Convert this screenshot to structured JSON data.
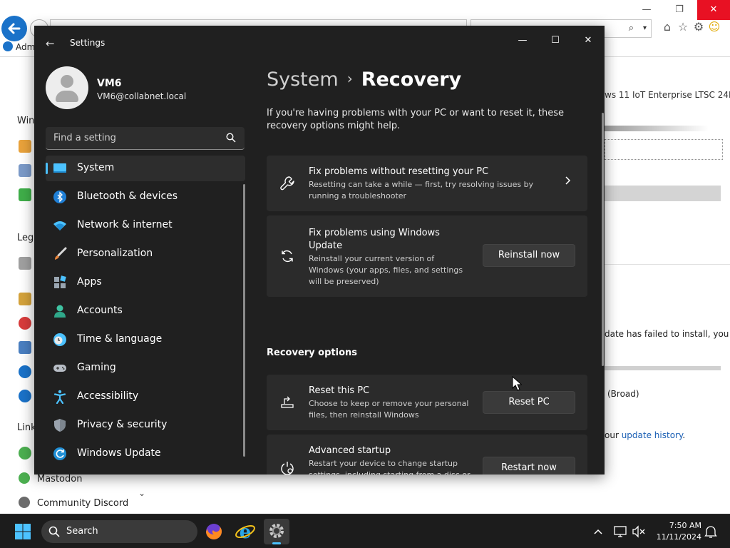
{
  "background_window": {
    "tab_title": "Adm",
    "sidebar_headings": [
      "Win",
      "Leg",
      "Link"
    ],
    "sidebar_links": [
      "Mastodon",
      "Community Discord"
    ],
    "edition_text": "ws 11 IoT Enterprise LTSC 24H2",
    "update_failed_text": "date has failed to install, you",
    "broad_text": "(Broad)",
    "history_prefix": "our ",
    "history_link": "update history",
    "history_suffix": "."
  },
  "settings": {
    "window_title": "Settings",
    "user": {
      "name": "VM6",
      "email": "VM6@collabnet.local"
    },
    "search_placeholder": "Find a setting",
    "nav": [
      {
        "label": "System",
        "icon": "system-display-icon",
        "selected": true
      },
      {
        "label": "Bluetooth & devices",
        "icon": "bluetooth-icon"
      },
      {
        "label": "Network & internet",
        "icon": "wifi-icon"
      },
      {
        "label": "Personalization",
        "icon": "paintbrush-icon"
      },
      {
        "label": "Apps",
        "icon": "apps-icon"
      },
      {
        "label": "Accounts",
        "icon": "account-person-icon"
      },
      {
        "label": "Time & language",
        "icon": "clock-globe-icon"
      },
      {
        "label": "Gaming",
        "icon": "gamepad-icon"
      },
      {
        "label": "Accessibility",
        "icon": "accessibility-icon"
      },
      {
        "label": "Privacy & security",
        "icon": "shield-icon"
      },
      {
        "label": "Windows Update",
        "icon": "windows-update-icon"
      }
    ],
    "breadcrumb": {
      "parent": "System",
      "separator": "›",
      "current": "Recovery"
    },
    "intro": "If you're having problems with your PC or want to reset it, these recovery options might help.",
    "cards": [
      {
        "title": "Fix problems without resetting your PC",
        "description": "Resetting can take a while — first, try resolving issues by running a troubleshooter",
        "icon": "wrench-icon"
      },
      {
        "title": "Fix problems using Windows Update",
        "description": "Reinstall your current version of Windows (your apps, files, and settings will be preserved)",
        "button": "Reinstall now",
        "icon": "sync-icon"
      }
    ],
    "section_title": "Recovery options",
    "recovery_options": [
      {
        "title": "Reset this PC",
        "description": "Choose to keep or remove your personal files, then reinstall Windows",
        "button": "Reset PC",
        "icon": "reset-pc-icon"
      },
      {
        "title": "Advanced startup",
        "description": "Restart your device to change startup settings, including starting from a disc or USB drive",
        "button": "Restart now",
        "icon": "advanced-startup-icon"
      }
    ]
  },
  "taskbar": {
    "search_label": "Search",
    "time": "7:50 AM",
    "date": "11/11/2024",
    "accent": "#4cc2ff"
  }
}
